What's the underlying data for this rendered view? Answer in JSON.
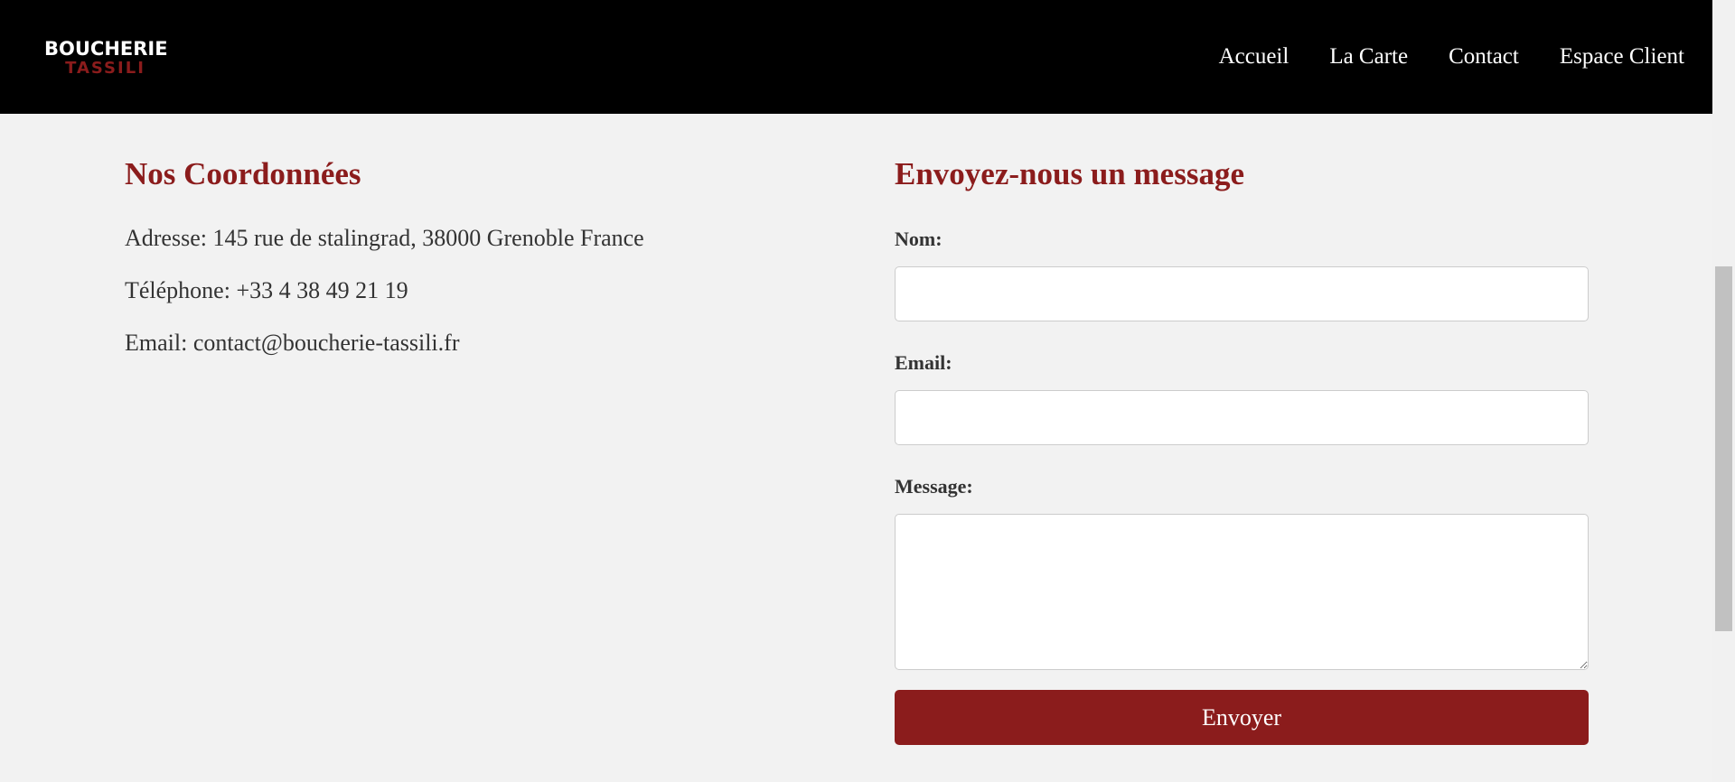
{
  "brand": {
    "name_top": "BOUCHERIE",
    "name_bottom": "TASSILI",
    "accent_color": "#8b1c1c"
  },
  "nav": {
    "items": [
      {
        "label": "Accueil"
      },
      {
        "label": "La Carte"
      },
      {
        "label": "Contact"
      },
      {
        "label": "Espace Client"
      }
    ]
  },
  "contact_info": {
    "title": "Nos Coordonnées",
    "address": "Adresse: 145 rue de stalingrad, 38000 Grenoble France",
    "phone": "Téléphone: +33 4 38 49 21 19",
    "email": "Email: contact@boucherie-tassili.fr"
  },
  "form": {
    "title": "Envoyez-nous un message",
    "name_label": "Nom:",
    "name_value": "",
    "email_label": "Email:",
    "email_value": "",
    "message_label": "Message:",
    "message_value": "",
    "submit_label": "Envoyer"
  }
}
